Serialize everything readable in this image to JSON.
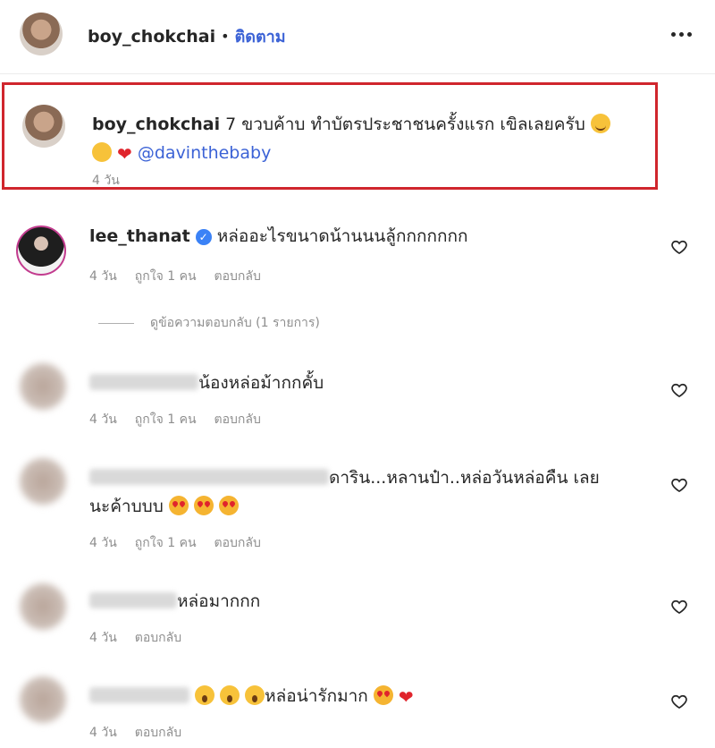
{
  "post": {
    "username": "boy_chokchai",
    "separator": "•",
    "follow_label": "ติดตาม"
  },
  "caption": {
    "username": "boy_chokchai",
    "text": " 7 ขวบค้าบ ทำบัตรประชาชนครั้งแรก เขิลเลยครับ",
    "mention": "@davinthebaby",
    "time": "4 วัน",
    "highlight_color": "#d0262d"
  },
  "comments": [
    {
      "username": "lee_thanat",
      "verified": true,
      "text": "หล่ออะไรขนาดน้านนนลู้กกกกกกก",
      "time": "4 วัน",
      "likes": "ถูกใจ 1 คน",
      "reply": "ตอบกลับ",
      "view_replies": "ดูข้อความตอบกลับ (1 รายการ)"
    },
    {
      "text": "น้องหล่อม้ากกคั้บ",
      "time": "4 วัน",
      "likes": "ถูกใจ 1 คน",
      "reply": "ตอบกลับ"
    },
    {
      "text": "ดาริน...หลานป๋า..หล่อวันหล่อคืน เลย",
      "text2": "นะค้าบบบ",
      "time": "4 วัน",
      "likes": "ถูกใจ 1 คน",
      "reply": "ตอบกลับ"
    },
    {
      "text": "หล่อมากกก",
      "time": "4 วัน",
      "reply": "ตอบกลับ"
    },
    {
      "text": "หล่อน่ารักมาก",
      "time": "4 วัน",
      "reply": "ตอบกลับ"
    }
  ],
  "icons": {
    "more": "more-horizontal-icon",
    "like": "heart-outline-icon",
    "verified": "verified-badge-icon"
  },
  "colors": {
    "link": "#3b62d6",
    "muted": "#8e8e8e",
    "heart_emoji": "#e0242c"
  }
}
